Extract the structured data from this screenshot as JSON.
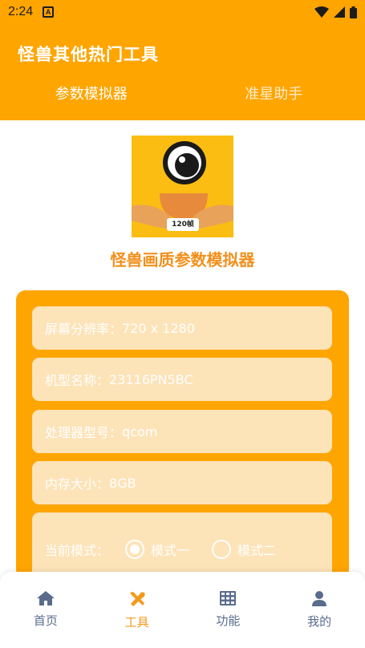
{
  "status_bar": {
    "time": "2:24",
    "app_badge": "A"
  },
  "header": {
    "title": "怪兽其他热门工具",
    "tabs": [
      {
        "label": "参数模拟器",
        "active": true
      },
      {
        "label": "准星助手",
        "active": false
      }
    ]
  },
  "logo": {
    "badge_text": "120帧"
  },
  "main": {
    "heading": "怪兽画质参数模拟器",
    "fields": [
      {
        "label": "屏幕分辨率：",
        "value": "720 x 1280"
      },
      {
        "label": "机型名称：",
        "value": "23116PN5BC"
      },
      {
        "label": "处理器型号：",
        "value": "qcom"
      },
      {
        "label": "内存大小：",
        "value": "8GB"
      }
    ],
    "mode": {
      "label": "当前模式：",
      "options": [
        "模式一",
        "模式二"
      ],
      "selected": "模式一"
    }
  },
  "bottom_nav": {
    "items": [
      {
        "label": "首页",
        "icon": "home-icon",
        "active": false
      },
      {
        "label": "工具",
        "icon": "tools-icon",
        "active": true
      },
      {
        "label": "功能",
        "icon": "grid-icon",
        "active": false
      },
      {
        "label": "我的",
        "icon": "user-icon",
        "active": false
      }
    ]
  },
  "colors": {
    "primary": "#ffa500",
    "accent_text": "#f28f1c",
    "field_bg": "#fde3b8",
    "nav_inactive": "#5a6c8c",
    "nav_active": "#f29a1e"
  }
}
